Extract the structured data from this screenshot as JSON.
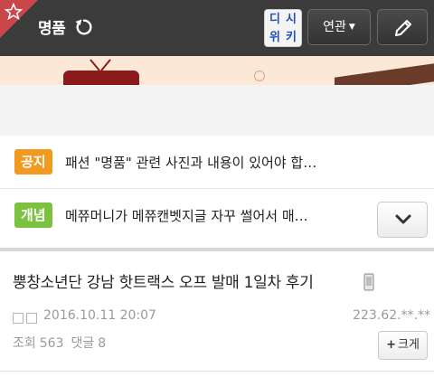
{
  "header": {
    "title": "명품",
    "dcwiki": [
      "디",
      "시",
      "위",
      "키"
    ],
    "related_label": "연관",
    "related_caret": "▼"
  },
  "notices": [
    {
      "badge": "공지",
      "text": "패션 \"명품\" 관련 사진과 내용이 있어야 합…"
    },
    {
      "badge": "개념",
      "text": "메쮸머니가 메쮸캔벳지글 자꾸 썰어서 매…"
    }
  ],
  "post": {
    "title": "뿡창소년단 강남 핫트랙스 오프 발매 1일차 후기",
    "date": "2016.10.11 20:07",
    "ip": "223.62.**.**",
    "views_label": "조회",
    "views": "563",
    "comments_label": "댓글",
    "comments": "8",
    "enlarge_plus": "+",
    "enlarge_label": "크게"
  },
  "colors": {
    "topbar": "#3b3b3b",
    "star_corner": "#c9474b",
    "notice_badge": "#f29a1f",
    "concept_badge": "#7cc241"
  },
  "icons": [
    "star-icon",
    "refresh-icon",
    "pencil-icon",
    "chevron-down-icon",
    "mobile-icon"
  ]
}
